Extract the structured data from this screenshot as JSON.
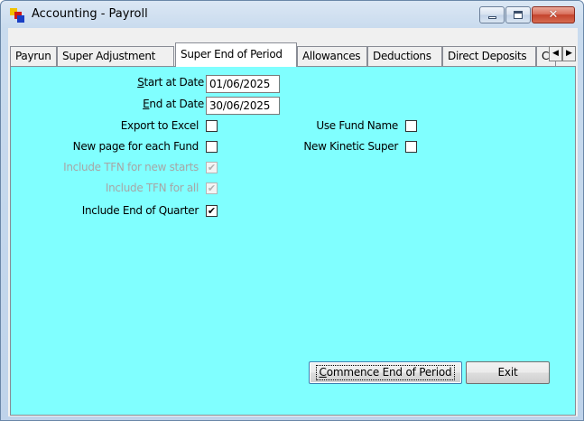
{
  "window": {
    "title": "Accounting - Payroll",
    "close_glyph": "✕"
  },
  "tabs": [
    {
      "label": "Payrun",
      "active": false
    },
    {
      "label": "Super Adjustment",
      "active": false
    },
    {
      "label": "Super End of Period",
      "active": true
    },
    {
      "label": "Allowances",
      "active": false
    },
    {
      "label": "Deductions",
      "active": false
    },
    {
      "label": "Direct Deposits",
      "active": false
    },
    {
      "label": "C",
      "active": false
    }
  ],
  "tab_scroll": {
    "left": "◀",
    "right": "▶"
  },
  "form": {
    "start_date_label_ul": "S",
    "start_date_label_rest": "tart at Date",
    "start_date_value": "01/06/2025",
    "end_date_label_ul": "E",
    "end_date_label_rest": "nd at Date",
    "end_date_value": "30/06/2025",
    "export_excel_label": "Export to Excel",
    "export_excel_checked": false,
    "new_page_label": "New page for each Fund",
    "new_page_checked": false,
    "tfn_new_label": "Include TFN for new starts",
    "tfn_new_checked": true,
    "tfn_all_label": "Include TFN for all",
    "tfn_all_checked": true,
    "end_quarter_label": "Include End of Quarter",
    "end_quarter_checked": true,
    "use_fund_name_label": "Use Fund Name",
    "use_fund_name_checked": false,
    "new_kinetic_label": "New Kinetic Super",
    "new_kinetic_checked": false,
    "check_glyph": "✔"
  },
  "buttons": {
    "commence_ul": "C",
    "commence_rest": "ommence End of Period",
    "exit": "Exit"
  },
  "colors": {
    "panel_bg": "#80ffff",
    "close_button": "#c4432c"
  }
}
